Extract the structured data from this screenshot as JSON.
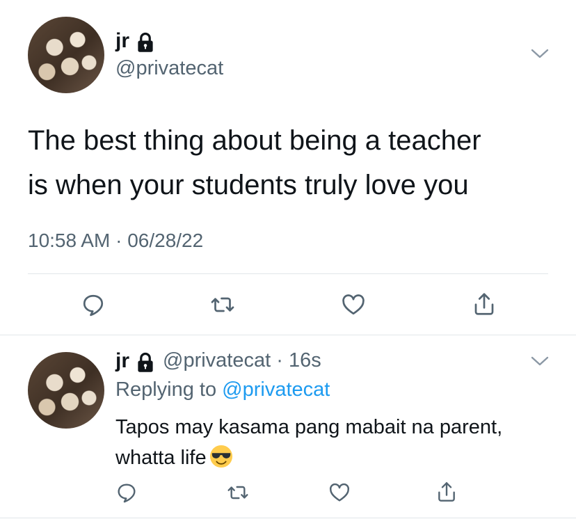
{
  "tweet": {
    "author_name": "jr",
    "author_handle": "@privatecat",
    "text_line1": "The best thing about being a teacher",
    "text_line2": "is when your students truly love you",
    "time": "10:58 AM",
    "date": "06/28/22",
    "meta_sep": "·"
  },
  "reply": {
    "author_name": "jr",
    "author_handle": "@privatecat",
    "sep": "·",
    "age": "16s",
    "replying_prefix": "Replying to",
    "replying_to": "@privatecat",
    "text_line1": "Tapos may kasama pang mabait na parent,",
    "text_line2": "whatta life"
  },
  "icons": {
    "lock": "lock-icon",
    "chevron": "chevron-down-icon",
    "reply": "reply-icon",
    "retweet": "retweet-icon",
    "like": "heart-icon",
    "share": "share-icon",
    "emoji": "sunglasses-emoji"
  },
  "colors": {
    "text": "#0f1419",
    "secondary": "#536471",
    "link": "#1d9bf0",
    "divider": "#e1e6ea"
  }
}
